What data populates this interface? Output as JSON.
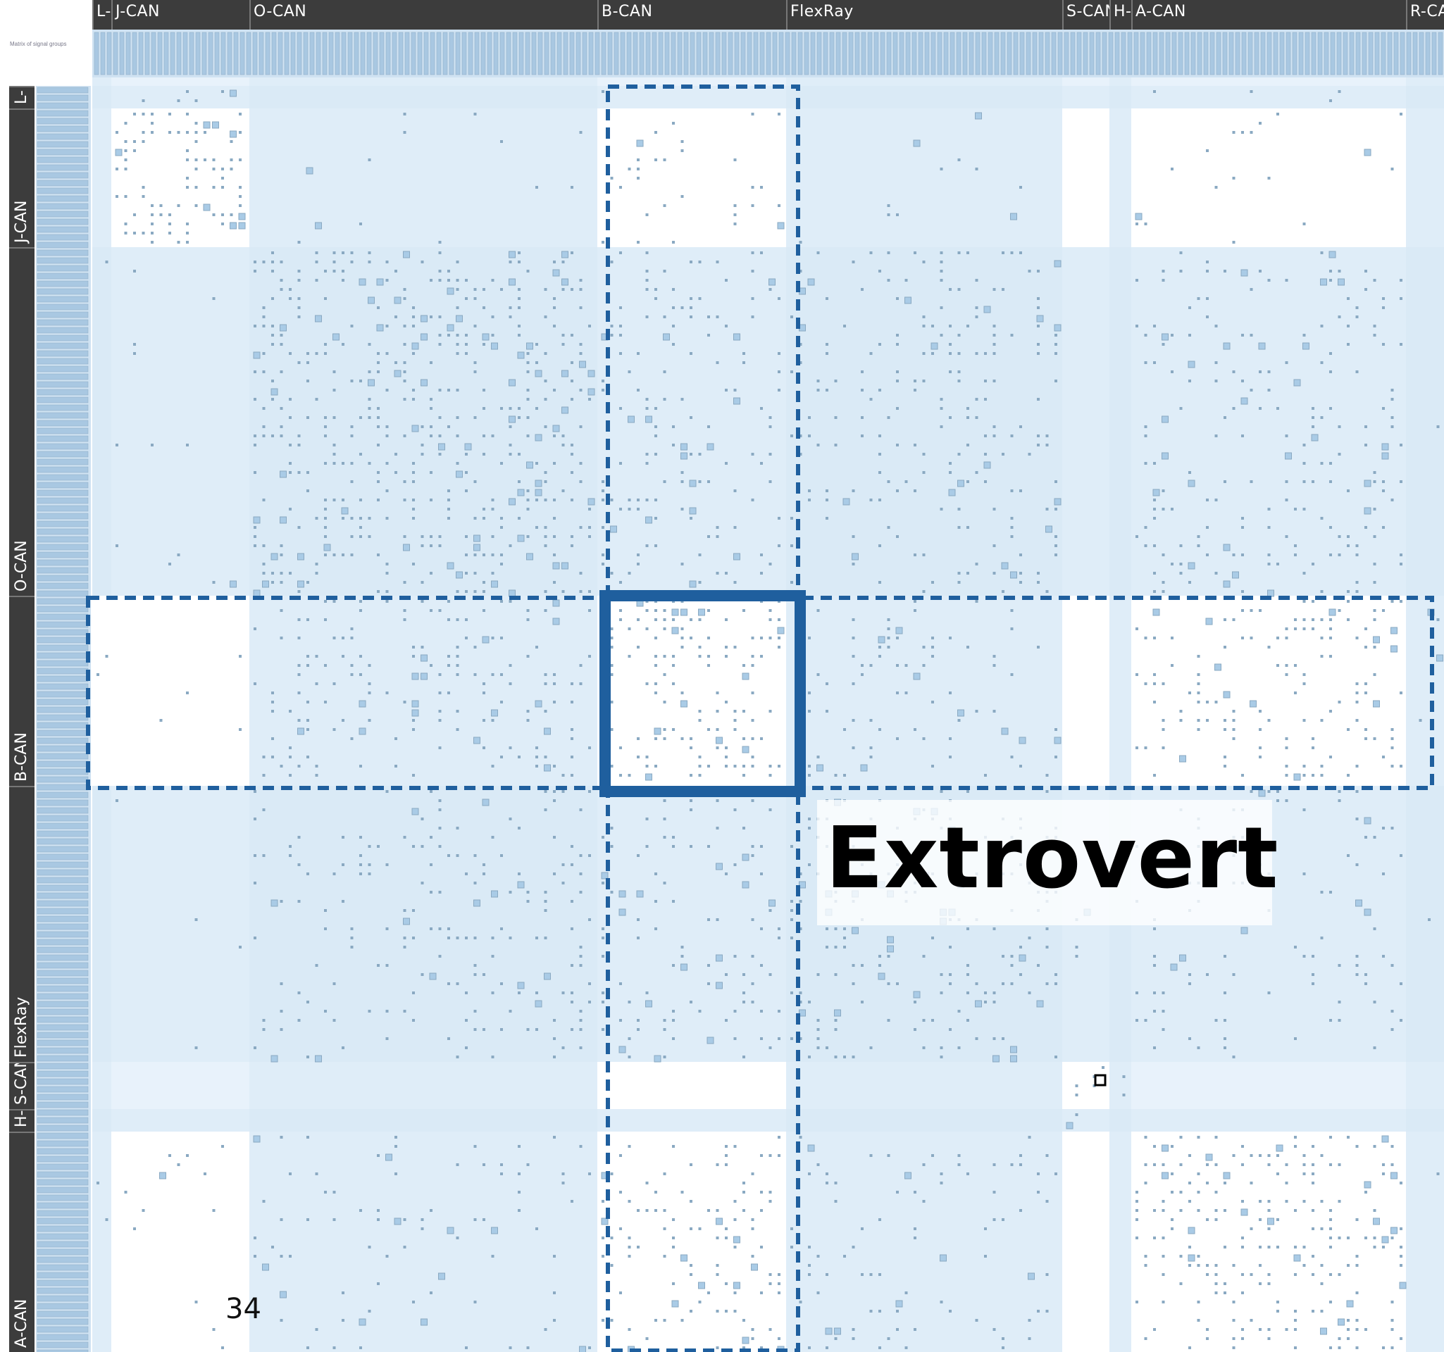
{
  "tiny_label": "Matrix of signal groups",
  "groups": [
    {
      "name": "L-CAN",
      "top_label": "L-C",
      "side_label": "L-"
    },
    {
      "name": "J-CAN",
      "top_label": "J-CAN",
      "side_label": "J-CAN"
    },
    {
      "name": "O-CAN",
      "top_label": "O-CAN",
      "side_label": "O-CAN"
    },
    {
      "name": "B-CAN",
      "top_label": "B-CAN",
      "side_label": "B-CAN"
    },
    {
      "name": "FlexRay",
      "top_label": "FlexRay",
      "side_label": "FlexRay"
    },
    {
      "name": "S-CAN",
      "top_label": "S-CAN",
      "side_label": "S-CAN"
    },
    {
      "name": "H-CAN",
      "top_label": "H-C",
      "side_label": "H-"
    },
    {
      "name": "A-CAN",
      "top_label": "A-CAN",
      "side_label": "A-CAN"
    },
    {
      "name": "R-CAN",
      "top_label": "R-CA",
      "side_label": ""
    }
  ],
  "highlight": {
    "focus_group": "B-CAN",
    "style": "dashed row and column band, thick frame on the diagonal block"
  },
  "callout": "Extrovert",
  "page_number": "34",
  "colors": {
    "header_bar": "#3c3c3c",
    "band_dark": "#d4e6f5",
    "band_light": "#e8f2fb",
    "block_fill": "#dceaf6",
    "cell": "#8aa9c2",
    "cell_fill": "#a9cbe6",
    "highlight": "#1f5f9e"
  }
}
